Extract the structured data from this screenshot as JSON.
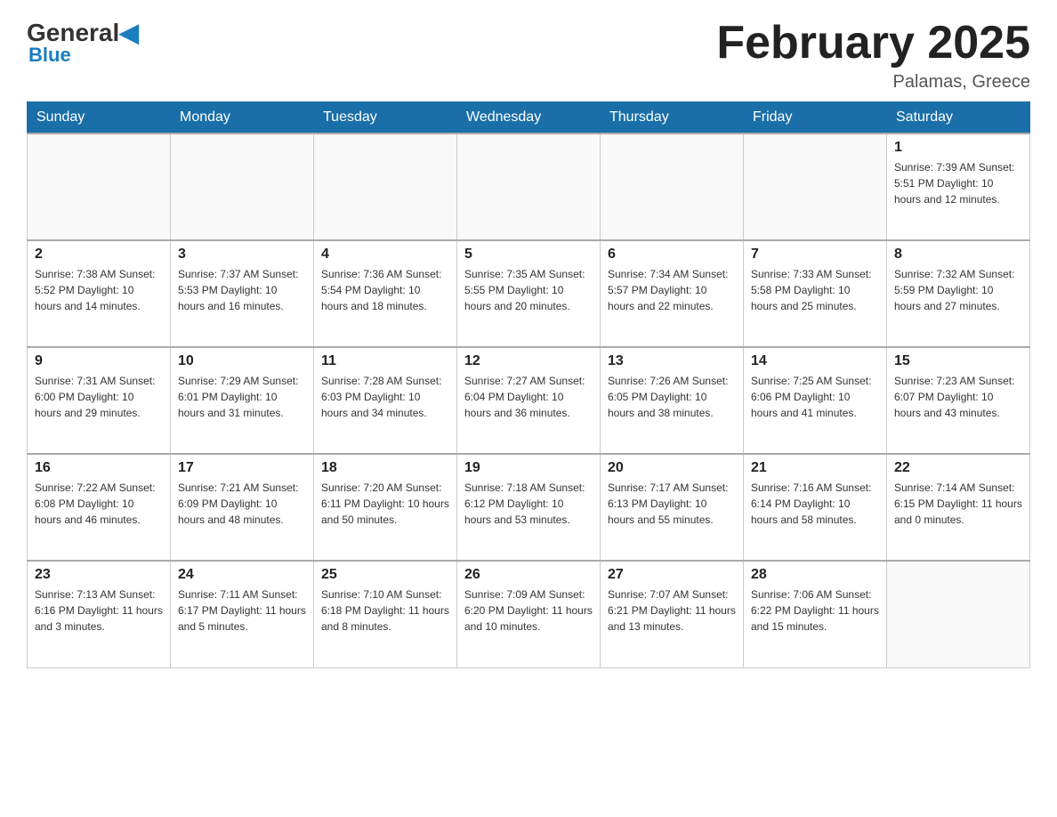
{
  "header": {
    "logo_general": "General",
    "logo_blue": "Blue",
    "month_title": "February 2025",
    "location": "Palamas, Greece"
  },
  "weekdays": [
    "Sunday",
    "Monday",
    "Tuesday",
    "Wednesday",
    "Thursday",
    "Friday",
    "Saturday"
  ],
  "weeks": [
    [
      {
        "day": "",
        "info": ""
      },
      {
        "day": "",
        "info": ""
      },
      {
        "day": "",
        "info": ""
      },
      {
        "day": "",
        "info": ""
      },
      {
        "day": "",
        "info": ""
      },
      {
        "day": "",
        "info": ""
      },
      {
        "day": "1",
        "info": "Sunrise: 7:39 AM\nSunset: 5:51 PM\nDaylight: 10 hours and 12 minutes."
      }
    ],
    [
      {
        "day": "2",
        "info": "Sunrise: 7:38 AM\nSunset: 5:52 PM\nDaylight: 10 hours and 14 minutes."
      },
      {
        "day": "3",
        "info": "Sunrise: 7:37 AM\nSunset: 5:53 PM\nDaylight: 10 hours and 16 minutes."
      },
      {
        "day": "4",
        "info": "Sunrise: 7:36 AM\nSunset: 5:54 PM\nDaylight: 10 hours and 18 minutes."
      },
      {
        "day": "5",
        "info": "Sunrise: 7:35 AM\nSunset: 5:55 PM\nDaylight: 10 hours and 20 minutes."
      },
      {
        "day": "6",
        "info": "Sunrise: 7:34 AM\nSunset: 5:57 PM\nDaylight: 10 hours and 22 minutes."
      },
      {
        "day": "7",
        "info": "Sunrise: 7:33 AM\nSunset: 5:58 PM\nDaylight: 10 hours and 25 minutes."
      },
      {
        "day": "8",
        "info": "Sunrise: 7:32 AM\nSunset: 5:59 PM\nDaylight: 10 hours and 27 minutes."
      }
    ],
    [
      {
        "day": "9",
        "info": "Sunrise: 7:31 AM\nSunset: 6:00 PM\nDaylight: 10 hours and 29 minutes."
      },
      {
        "day": "10",
        "info": "Sunrise: 7:29 AM\nSunset: 6:01 PM\nDaylight: 10 hours and 31 minutes."
      },
      {
        "day": "11",
        "info": "Sunrise: 7:28 AM\nSunset: 6:03 PM\nDaylight: 10 hours and 34 minutes."
      },
      {
        "day": "12",
        "info": "Sunrise: 7:27 AM\nSunset: 6:04 PM\nDaylight: 10 hours and 36 minutes."
      },
      {
        "day": "13",
        "info": "Sunrise: 7:26 AM\nSunset: 6:05 PM\nDaylight: 10 hours and 38 minutes."
      },
      {
        "day": "14",
        "info": "Sunrise: 7:25 AM\nSunset: 6:06 PM\nDaylight: 10 hours and 41 minutes."
      },
      {
        "day": "15",
        "info": "Sunrise: 7:23 AM\nSunset: 6:07 PM\nDaylight: 10 hours and 43 minutes."
      }
    ],
    [
      {
        "day": "16",
        "info": "Sunrise: 7:22 AM\nSunset: 6:08 PM\nDaylight: 10 hours and 46 minutes."
      },
      {
        "day": "17",
        "info": "Sunrise: 7:21 AM\nSunset: 6:09 PM\nDaylight: 10 hours and 48 minutes."
      },
      {
        "day": "18",
        "info": "Sunrise: 7:20 AM\nSunset: 6:11 PM\nDaylight: 10 hours and 50 minutes."
      },
      {
        "day": "19",
        "info": "Sunrise: 7:18 AM\nSunset: 6:12 PM\nDaylight: 10 hours and 53 minutes."
      },
      {
        "day": "20",
        "info": "Sunrise: 7:17 AM\nSunset: 6:13 PM\nDaylight: 10 hours and 55 minutes."
      },
      {
        "day": "21",
        "info": "Sunrise: 7:16 AM\nSunset: 6:14 PM\nDaylight: 10 hours and 58 minutes."
      },
      {
        "day": "22",
        "info": "Sunrise: 7:14 AM\nSunset: 6:15 PM\nDaylight: 11 hours and 0 minutes."
      }
    ],
    [
      {
        "day": "23",
        "info": "Sunrise: 7:13 AM\nSunset: 6:16 PM\nDaylight: 11 hours and 3 minutes."
      },
      {
        "day": "24",
        "info": "Sunrise: 7:11 AM\nSunset: 6:17 PM\nDaylight: 11 hours and 5 minutes."
      },
      {
        "day": "25",
        "info": "Sunrise: 7:10 AM\nSunset: 6:18 PM\nDaylight: 11 hours and 8 minutes."
      },
      {
        "day": "26",
        "info": "Sunrise: 7:09 AM\nSunset: 6:20 PM\nDaylight: 11 hours and 10 minutes."
      },
      {
        "day": "27",
        "info": "Sunrise: 7:07 AM\nSunset: 6:21 PM\nDaylight: 11 hours and 13 minutes."
      },
      {
        "day": "28",
        "info": "Sunrise: 7:06 AM\nSunset: 6:22 PM\nDaylight: 11 hours and 15 minutes."
      },
      {
        "day": "",
        "info": ""
      }
    ]
  ]
}
